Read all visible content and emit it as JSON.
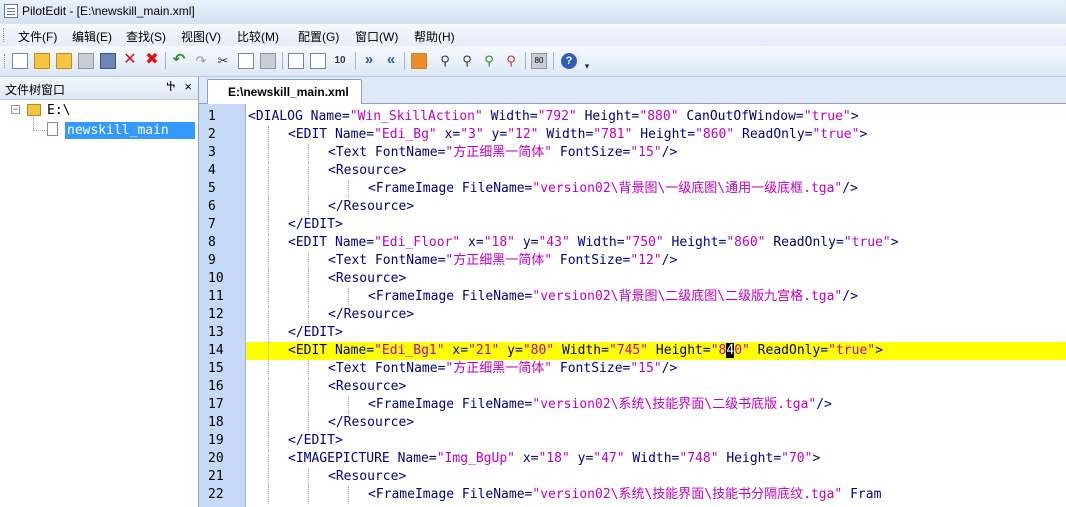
{
  "window": {
    "title": "PilotEdit - [E:\\newskill_main.xml]"
  },
  "menu": [
    "文件(F)",
    "编辑(E)",
    "查找(S)",
    "视图(V)",
    "比较(M)",
    "配置(G)",
    "窗口(W)",
    "帮助(H)"
  ],
  "toolbar": {
    "icons": [
      "new-file-icon",
      "open-file-icon",
      "open-folder-icon",
      "save-icon",
      "save-all-icon",
      "close-icon",
      "close-all-icon",
      "undo-icon",
      "redo-icon",
      "cut-icon",
      "copy-icon",
      "paste-icon",
      "find-icon",
      "find-next-icon",
      "replace-icon",
      "indent-icon",
      "outdent-icon",
      "bookmark-icon",
      "binoculars-icon",
      "find-in-files-icon",
      "replace-in-files-icon",
      "filter-icon",
      "hex-icon",
      "help-icon"
    ],
    "hex_label": "80",
    "help_label": "?"
  },
  "file_tree": {
    "title": "文件树窗口",
    "pin": "ᵖ",
    "close": "×",
    "root": "E:\\",
    "file": "newskill_main"
  },
  "editor": {
    "tab": "E:\\newskill_main.xml",
    "cursor": {
      "line": 14
    },
    "lines": [
      {
        "n": "1",
        "indent": 0,
        "tokens": [
          [
            "k",
            "<DIALOG "
          ],
          [
            "a",
            "Name="
          ],
          [
            "s",
            "\"Win_SkillAction\""
          ],
          [
            "a",
            " Width="
          ],
          [
            "s",
            "\"792\""
          ],
          [
            "a",
            " Height="
          ],
          [
            "s",
            "\"880\""
          ],
          [
            "a",
            " CanOutOfWindow="
          ],
          [
            "s",
            "\"true\""
          ],
          [
            "k",
            ">"
          ]
        ]
      },
      {
        "n": "2",
        "indent": 1,
        "tokens": [
          [
            "k",
            "<EDIT "
          ],
          [
            "a",
            "Name="
          ],
          [
            "s",
            "\"Edi_Bg\""
          ],
          [
            "a",
            " x="
          ],
          [
            "s",
            "\"3\""
          ],
          [
            "a",
            " y="
          ],
          [
            "s",
            "\"12\""
          ],
          [
            "a",
            " Width="
          ],
          [
            "s",
            "\"781\""
          ],
          [
            "a",
            " Height="
          ],
          [
            "s",
            "\"860\""
          ],
          [
            "a",
            " ReadOnly="
          ],
          [
            "s",
            "\"true\""
          ],
          [
            "k",
            ">"
          ]
        ]
      },
      {
        "n": "3",
        "indent": 2,
        "tokens": [
          [
            "k",
            "<Text "
          ],
          [
            "a",
            "FontName="
          ],
          [
            "s",
            "\"方正细黑一简体\""
          ],
          [
            "a",
            " FontSize="
          ],
          [
            "s",
            "\"15\""
          ],
          [
            "k",
            "/>"
          ]
        ]
      },
      {
        "n": "4",
        "indent": 2,
        "tokens": [
          [
            "k",
            "<Resource>"
          ]
        ]
      },
      {
        "n": "5",
        "indent": 3,
        "tokens": [
          [
            "k",
            "<FrameImage "
          ],
          [
            "a",
            "FileName="
          ],
          [
            "s",
            "\"version02\\背景图\\一级底图\\通用一级底框.tga\""
          ],
          [
            "k",
            "/>"
          ]
        ]
      },
      {
        "n": "6",
        "indent": 2,
        "tokens": [
          [
            "k",
            "</Resource>"
          ]
        ]
      },
      {
        "n": "7",
        "indent": 1,
        "tokens": [
          [
            "k",
            "</EDIT>"
          ]
        ]
      },
      {
        "n": "8",
        "indent": 1,
        "tokens": [
          [
            "k",
            "<EDIT "
          ],
          [
            "a",
            "Name="
          ],
          [
            "s",
            "\"Edi_Floor\""
          ],
          [
            "a",
            " x="
          ],
          [
            "s",
            "\"18\""
          ],
          [
            "a",
            " y="
          ],
          [
            "s",
            "\"43\""
          ],
          [
            "a",
            " Width="
          ],
          [
            "s",
            "\"750\""
          ],
          [
            "a",
            " Height="
          ],
          [
            "s",
            "\"860\""
          ],
          [
            "a",
            " ReadOnly="
          ],
          [
            "s",
            "\"true\""
          ],
          [
            "k",
            ">"
          ]
        ]
      },
      {
        "n": "9",
        "indent": 2,
        "tokens": [
          [
            "k",
            "<Text "
          ],
          [
            "a",
            "FontName="
          ],
          [
            "s",
            "\"方正细黑一简体\""
          ],
          [
            "a",
            " FontSize="
          ],
          [
            "s",
            "\"12\""
          ],
          [
            "k",
            "/>"
          ]
        ]
      },
      {
        "n": "10",
        "indent": 2,
        "tokens": [
          [
            "k",
            "<Resource>"
          ]
        ]
      },
      {
        "n": "11",
        "indent": 3,
        "tokens": [
          [
            "k",
            "<FrameImage "
          ],
          [
            "a",
            "FileName="
          ],
          [
            "s",
            "\"version02\\背景图\\二级底图\\二级版九宫格.tga\""
          ],
          [
            "k",
            "/>"
          ]
        ]
      },
      {
        "n": "12",
        "indent": 2,
        "tokens": [
          [
            "k",
            "</Resource>"
          ]
        ]
      },
      {
        "n": "13",
        "indent": 1,
        "tokens": [
          [
            "k",
            "</EDIT>"
          ]
        ]
      },
      {
        "n": "14",
        "indent": 1,
        "tokens": [
          [
            "k",
            "<EDIT "
          ],
          [
            "a",
            "Name="
          ],
          [
            "s",
            "\"Edi_Bg1\""
          ],
          [
            "a",
            " x="
          ],
          [
            "s",
            "\"21\""
          ],
          [
            "a",
            " y="
          ],
          [
            "s",
            "\"80\""
          ],
          [
            "a",
            " Width="
          ],
          [
            "s",
            "\"745\""
          ],
          [
            "a",
            " Height="
          ],
          [
            "s",
            "\"8"
          ],
          [
            "c",
            "4"
          ],
          [
            "s",
            "0\""
          ],
          [
            "a",
            " ReadOnly="
          ],
          [
            "s",
            "\"true\""
          ],
          [
            "k",
            ">"
          ]
        ]
      },
      {
        "n": "15",
        "indent": 2,
        "tokens": [
          [
            "k",
            "<Text "
          ],
          [
            "a",
            "FontName="
          ],
          [
            "s",
            "\"方正细黑一简体\""
          ],
          [
            "a",
            " FontSize="
          ],
          [
            "s",
            "\"15\""
          ],
          [
            "k",
            "/>"
          ]
        ]
      },
      {
        "n": "16",
        "indent": 2,
        "tokens": [
          [
            "k",
            "<Resource>"
          ]
        ]
      },
      {
        "n": "17",
        "indent": 3,
        "tokens": [
          [
            "k",
            "<FrameImage "
          ],
          [
            "a",
            "FileName="
          ],
          [
            "s",
            "\"version02\\系统\\技能界面\\二级书底版.tga\""
          ],
          [
            "k",
            "/>"
          ]
        ]
      },
      {
        "n": "18",
        "indent": 2,
        "tokens": [
          [
            "k",
            "</Resource>"
          ]
        ]
      },
      {
        "n": "19",
        "indent": 1,
        "tokens": [
          [
            "k",
            "</EDIT>"
          ]
        ]
      },
      {
        "n": "20",
        "indent": 1,
        "tokens": [
          [
            "k",
            "<IMAGEPICTURE "
          ],
          [
            "a",
            "Name="
          ],
          [
            "s",
            "\"Img_BgUp\""
          ],
          [
            "a",
            " x="
          ],
          [
            "s",
            "\"18\""
          ],
          [
            "a",
            " y="
          ],
          [
            "s",
            "\"47\""
          ],
          [
            "a",
            " Width="
          ],
          [
            "s",
            "\"748\""
          ],
          [
            "a",
            " Height="
          ],
          [
            "s",
            "\"70\""
          ],
          [
            "k",
            ">"
          ]
        ]
      },
      {
        "n": "21",
        "indent": 2,
        "tokens": [
          [
            "k",
            "<Resource>"
          ]
        ]
      },
      {
        "n": "22",
        "indent": 3,
        "tokens": [
          [
            "k",
            "<FrameImage "
          ],
          [
            "a",
            "FileName="
          ],
          [
            "s",
            "\"version02\\系统\\技能界面\\技能书分隔底纹.tga\""
          ],
          [
            "a",
            " Fram"
          ]
        ]
      }
    ]
  }
}
